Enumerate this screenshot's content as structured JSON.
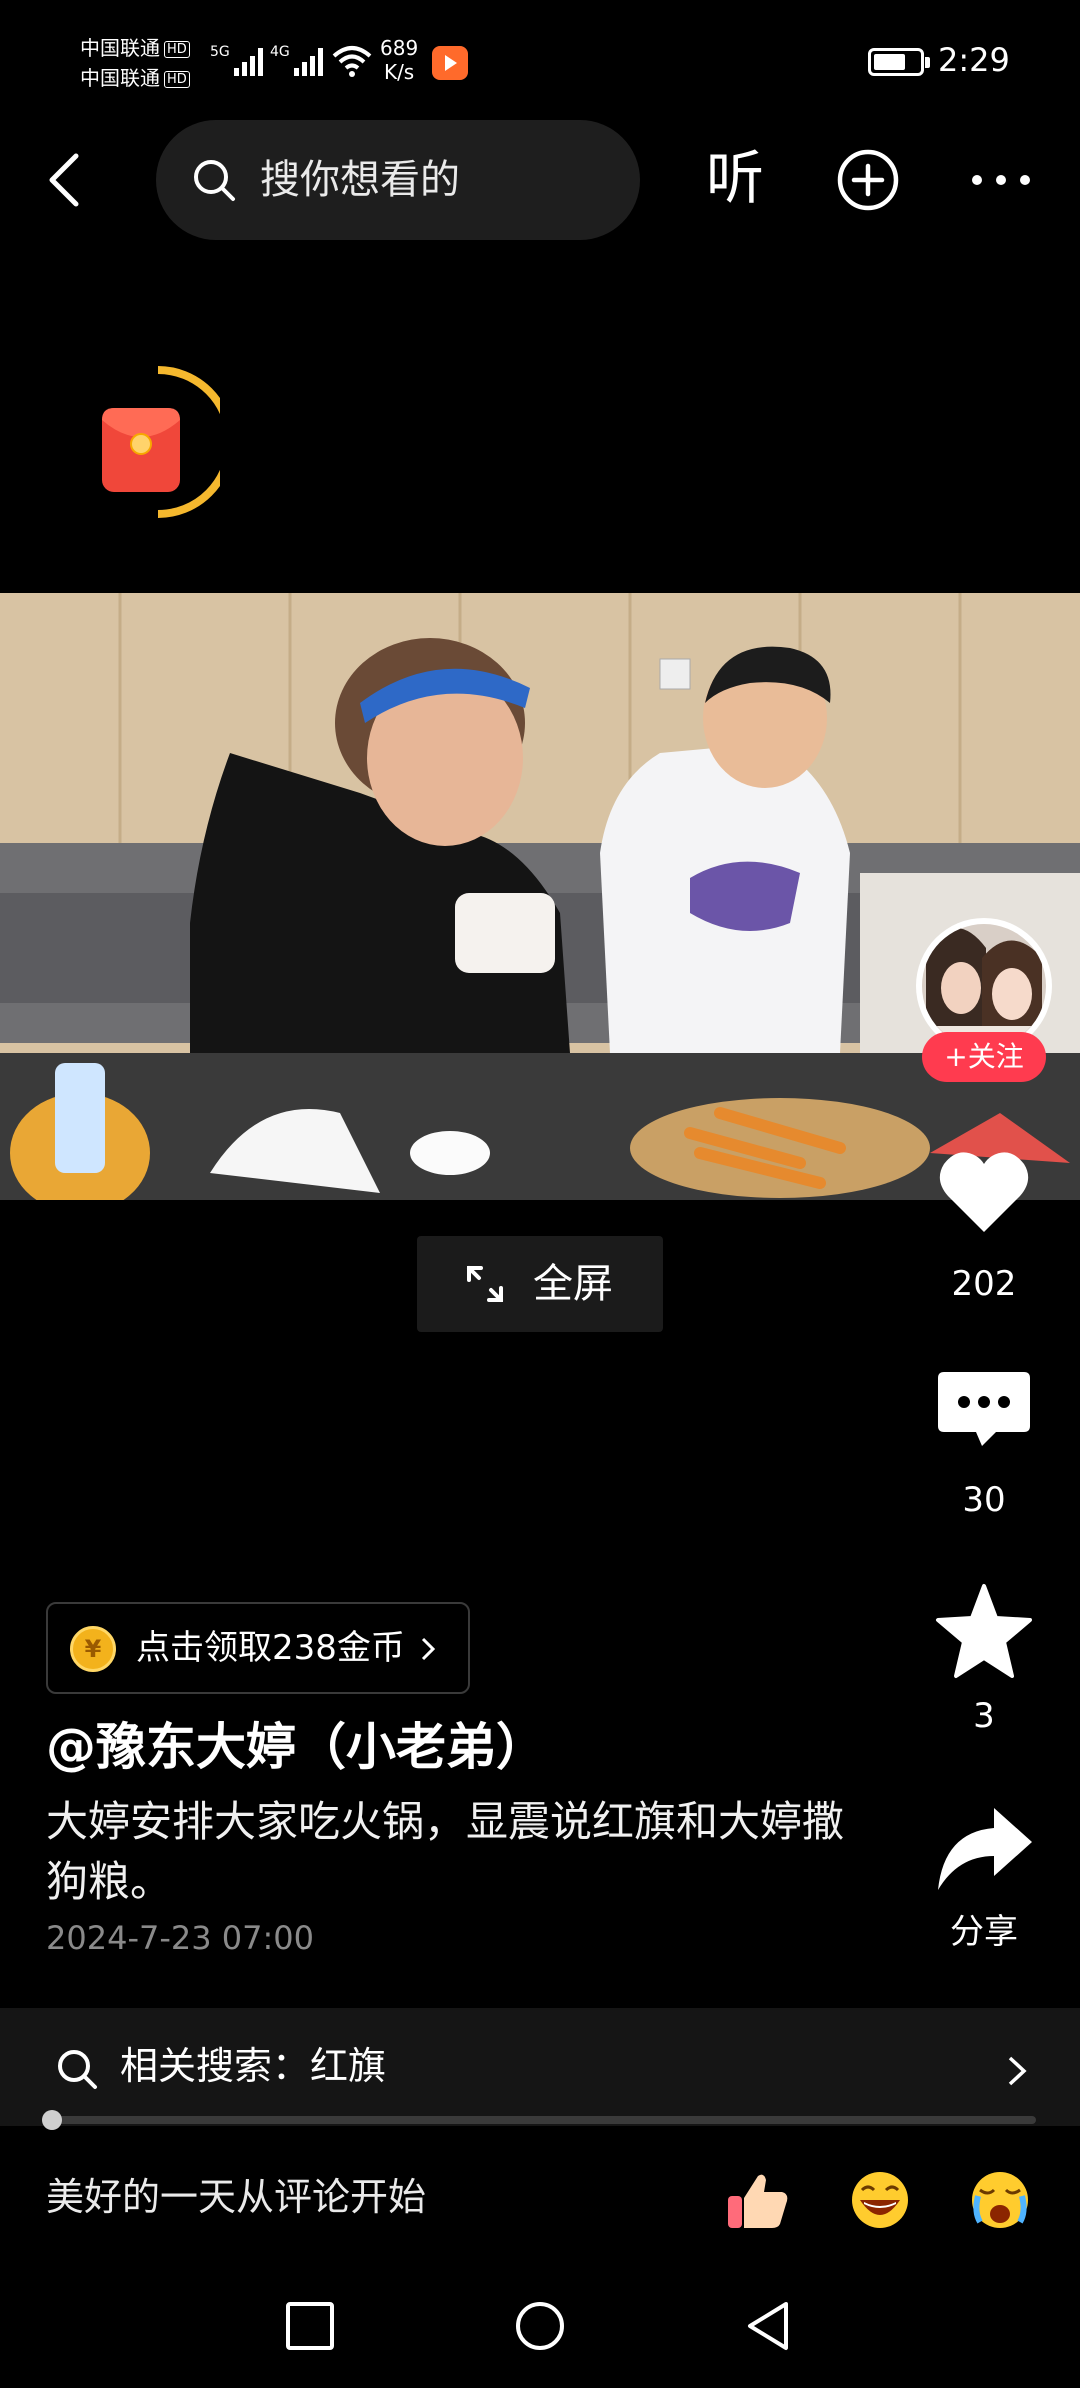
{
  "status_bar": {
    "carrier1": "中国联通",
    "carrier2": "中国联通",
    "hd_badge": "HD",
    "net1": "5G",
    "net2": "4G",
    "speed_value": "689",
    "speed_unit": "K/s",
    "time": "2:29",
    "battery_level_percent": 70
  },
  "top_bar": {
    "search_placeholder": "搜你想看的",
    "listen_label": "听"
  },
  "video": {
    "fullscreen_label": "全屏"
  },
  "right_rail": {
    "follow_label": "+关注",
    "likes": "202",
    "comments": "30",
    "favorites": "3",
    "share_label": "分享"
  },
  "post": {
    "coin_icon_text": "¥",
    "coin_label": "点击领取238金币",
    "author": "@豫东大婷（小老弟）",
    "description": "大婷安排大家吃火锅，显震说红旗和大婷撒狗粮。",
    "date": "2024-7-23 07:00"
  },
  "related_search": {
    "label": "相关搜索：红旗"
  },
  "playback": {
    "progress_fraction": 0.0
  },
  "comment_bar": {
    "placeholder": "美好的一天从评论开始",
    "emojis": [
      "thumbs-up-emoji",
      "laughing-emoji",
      "crying-emoji"
    ]
  },
  "colors": {
    "background": "#000000",
    "follow_red": "#ff3b4f",
    "coin_gold": "#f3b21c"
  }
}
